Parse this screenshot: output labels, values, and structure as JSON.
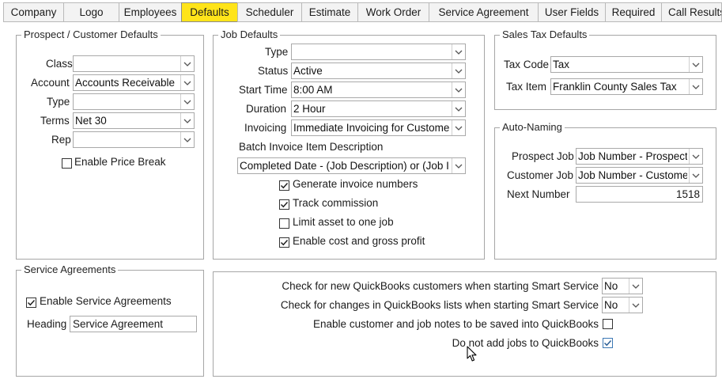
{
  "tabs": [
    {
      "label": "Company"
    },
    {
      "label": "Logo"
    },
    {
      "label": "Employees"
    },
    {
      "label": "Defaults"
    },
    {
      "label": "Scheduler"
    },
    {
      "label": "Estimate"
    },
    {
      "label": "Work Order"
    },
    {
      "label": "Service Agreement"
    },
    {
      "label": "User Fields"
    },
    {
      "label": "Required"
    },
    {
      "label": "Call Results"
    }
  ],
  "active_tab": "Defaults",
  "colors": {
    "active_tab": "#ffe41a",
    "border": "#a6a6a6"
  },
  "prospect": {
    "title": "Prospect / Customer Defaults",
    "class_label": "Class",
    "class_value": "",
    "account_label": "Account",
    "account_value": "Accounts Receivable",
    "type_label": "Type",
    "type_value": "",
    "terms_label": "Terms",
    "terms_value": "Net 30",
    "rep_label": "Rep",
    "rep_value": "",
    "price_break_label": "Enable Price Break",
    "price_break_checked": false
  },
  "job": {
    "title": "Job Defaults",
    "type_label": "Type",
    "type_value": "",
    "status_label": "Status",
    "status_value": "Active",
    "start_label": "Start Time",
    "start_value": "8:00 AM",
    "duration_label": "Duration",
    "duration_value": "2 Hour",
    "invoicing_label": "Invoicing",
    "invoicing_value": "Immediate Invoicing for Custome",
    "batch_label": "Batch Invoice Item Description",
    "batch_value": "Completed Date - (Job Description) or (Job I",
    "gen_invoice_label": "Generate invoice numbers",
    "gen_invoice_checked": true,
    "track_comm_label": "Track commission",
    "track_comm_checked": true,
    "limit_asset_label": "Limit asset to one job",
    "limit_asset_checked": false,
    "cost_profit_label": "Enable cost and gross profit",
    "cost_profit_checked": true
  },
  "sales_tax": {
    "title": "Sales Tax Defaults",
    "code_label": "Tax Code",
    "code_value": "Tax",
    "item_label": "Tax Item",
    "item_value": "Franklin County Sales Tax"
  },
  "auto_naming": {
    "title": "Auto-Naming",
    "prospect_label": "Prospect Job",
    "prospect_value": "Job Number - Prospect",
    "customer_label": "Customer Job",
    "customer_value": "Job Number - Custome",
    "next_label": "Next Number",
    "next_value": "1518"
  },
  "service_agreements": {
    "title": "Service Agreements",
    "enable_label": "Enable Service Agreements",
    "enable_checked": true,
    "heading_label": "Heading",
    "heading_value": "Service Agreement"
  },
  "qb": {
    "new_customers_label": "Check for new QuickBooks customers when starting Smart Service",
    "new_customers_value": "No",
    "list_changes_label": "Check for changes in QuickBooks lists when starting Smart Service",
    "list_changes_value": "No",
    "notes_label": "Enable customer and job notes to be saved into QuickBooks",
    "notes_checked": false,
    "no_jobs_label": "Do not add jobs to QuickBooks",
    "no_jobs_checked": true
  }
}
